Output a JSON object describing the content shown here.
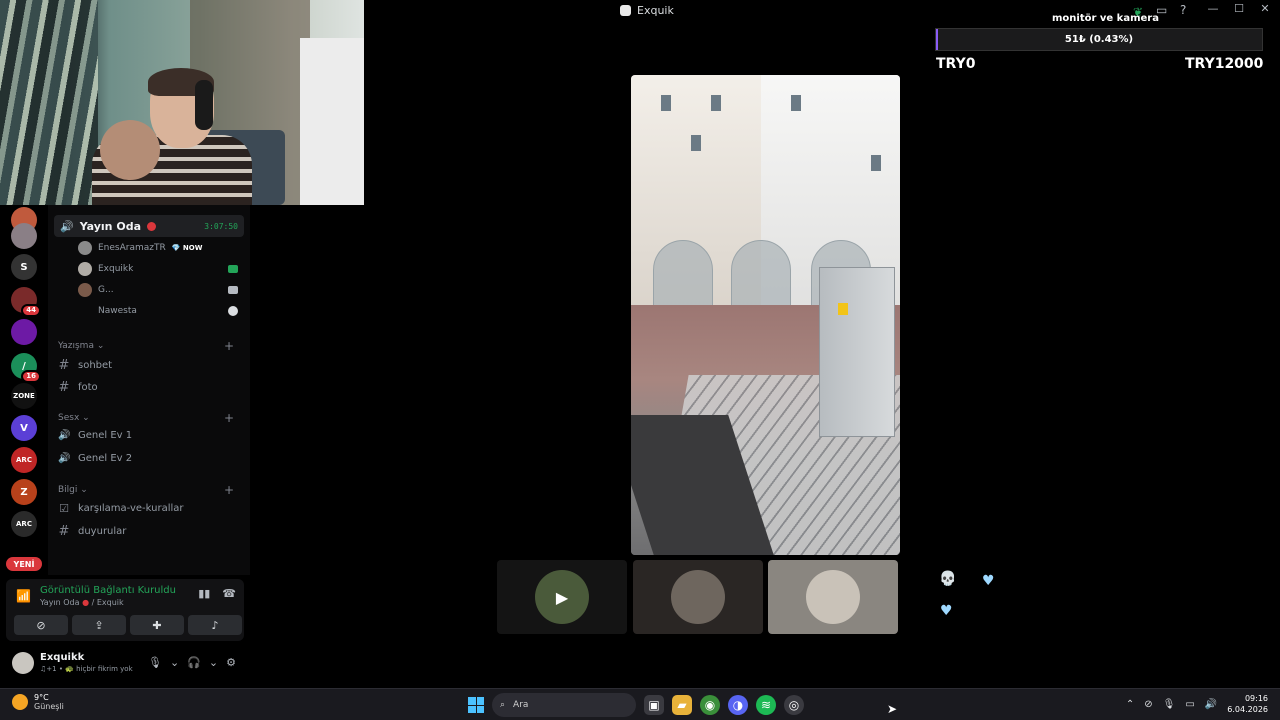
{
  "window": {
    "title": "Exquik",
    "minimize": "—",
    "maximize": "☐",
    "close": "✕"
  },
  "servers": [
    {
      "color": "#c05a3d"
    },
    {
      "color": "#8a7f86"
    },
    {
      "letter": "S",
      "color": "#333"
    },
    {
      "color": "#7a2a2a",
      "badge": "44"
    },
    {
      "color": "#6d1aa5"
    },
    {
      "letter": "/",
      "color": "#1b8f5a",
      "badge": "16"
    },
    {
      "letter": "ZONE",
      "color": "#111"
    },
    {
      "letter": "V",
      "color": "#5b3fd6"
    },
    {
      "letter": "ARC",
      "color": "#c02626"
    },
    {
      "letter": "Z",
      "color": "#b8411b"
    },
    {
      "letter": "ARC",
      "color": "#2a2a2a"
    }
  ],
  "new_label": "YENİ",
  "voice_channel": {
    "name": "Yayın Oda",
    "timer": "3:07:50",
    "members": [
      {
        "name": "EnesAramazTR",
        "tag": "💎 NOW"
      },
      {
        "name": "Exquikk"
      },
      {
        "name": "G..."
      },
      {
        "name": "Nawesta"
      }
    ]
  },
  "categories": [
    {
      "name": "Yazışma",
      "channels": [
        {
          "icon": "#",
          "name": "sohbet"
        },
        {
          "icon": "#",
          "name": "foto"
        }
      ]
    },
    {
      "name": "Sesx",
      "channels": [
        {
          "icon": "🔊",
          "name": "Genel Ev 1"
        },
        {
          "icon": "🔊",
          "name": "Genel Ev 2"
        }
      ]
    },
    {
      "name": "Bilgi",
      "channels": [
        {
          "icon": "☑",
          "name": "karşılama-ve-kurallar"
        },
        {
          "icon": "#",
          "name": "duyurular"
        }
      ]
    }
  ],
  "voice_panel": {
    "status": "Görüntülü Bağlantı Kuruldu",
    "channel": "Yayın Oda",
    "server": "/ Exquik"
  },
  "user": {
    "name": "Exquikk",
    "status": "♫+1 • 🐢 hiçbir fikrim yok"
  },
  "widget": {
    "scene": "monitör ve kamera",
    "goal_text": "51₺ (0.43%)",
    "goal_min": "TRY0",
    "goal_max": "TRY12000",
    "progress_fraction": 0.0043,
    "accent": "#8a5cf6"
  },
  "taskbar": {
    "temp": "9°C",
    "weather": "Güneşli",
    "search_placeholder": "Ara",
    "time": "09:16",
    "date": "6.04.2026"
  },
  "colors": {
    "online": "#23a559",
    "live": "#da373c",
    "blurple": "#5865f2"
  }
}
